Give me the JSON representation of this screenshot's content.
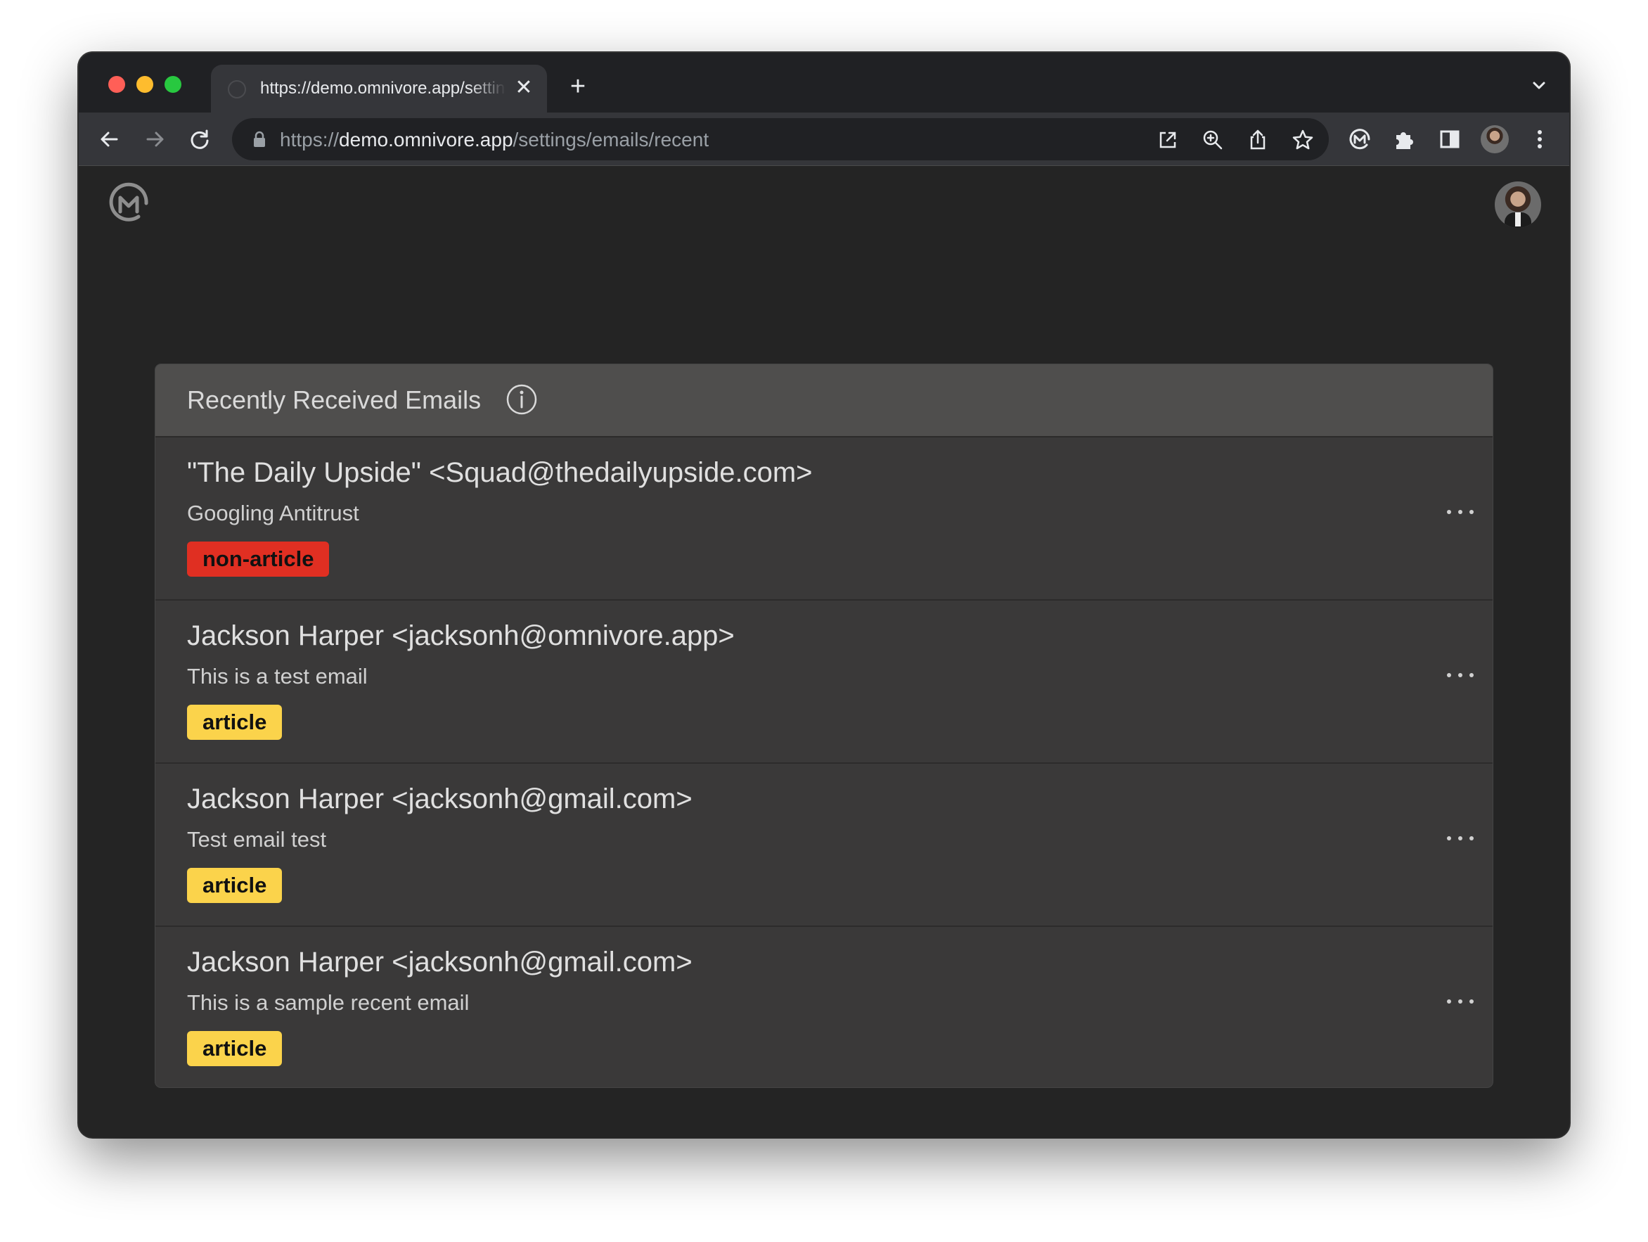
{
  "browser": {
    "tab_title": "https://demo.omnivore.app/settings/emails/recent",
    "tab_close": "✕",
    "new_tab": "+",
    "url_scheme": "https://",
    "url_host": "demo.omnivore.app",
    "url_path": "/settings/emails/recent"
  },
  "card": {
    "title": "Recently Received Emails"
  },
  "emails": [
    {
      "from": "\"The Daily Upside\" <Squad@thedailyupside.com>",
      "subject": "Googling Antitrust",
      "badge": "non-article",
      "badge_color": "#e02f22"
    },
    {
      "from": "Jackson Harper <jacksonh@omnivore.app>",
      "subject": "This is a test email",
      "badge": "article",
      "badge_color": "#fbd34b"
    },
    {
      "from": "Jackson Harper <jacksonh@gmail.com>",
      "subject": "Test email test",
      "badge": "article",
      "badge_color": "#fbd34b"
    },
    {
      "from": "Jackson Harper <jacksonh@gmail.com>",
      "subject": "This is a sample recent email",
      "badge": "article",
      "badge_color": "#fbd34b"
    }
  ],
  "colors": {
    "page_bg": "#242424",
    "card_bg": "#3a3939",
    "card_header_bg": "#4f4e4d",
    "accent_red": "#e02f22",
    "accent_yellow": "#fbd34b"
  },
  "icons": [
    "back-icon",
    "forward-icon",
    "reload-icon",
    "lock-icon",
    "open-in-icon",
    "zoom-icon",
    "share-icon",
    "star-icon",
    "omnivore-extension-icon",
    "extensions-icon",
    "sidepanel-icon",
    "profile-avatar",
    "kebab-menu-icon",
    "omnivore-logo",
    "info-icon",
    "more-icon"
  ]
}
